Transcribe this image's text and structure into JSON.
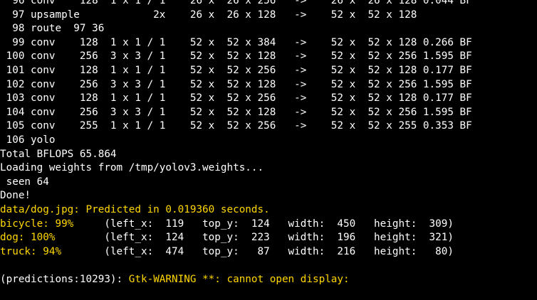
{
  "terminal": {
    "background": "#000000",
    "text_color": "#ffffff",
    "highlight_color": "#ffd700",
    "lines": [
      "  96 conv    128  1 x 1 / 1    26 x  26 x 256   ->    26 x  26 x 128 0.044 BF",
      "  97 upsample            2x    26 x  26 x 128   ->    52 x  52 x 128",
      "  98 route  97 36",
      "  99 conv    128  1 x 1 / 1    52 x  52 x 384   ->    52 x  52 x 128 0.266 BF",
      " 100 conv    256  3 x 3 / 1    52 x  52 x 128   ->    52 x  52 x 256 1.595 BF",
      " 101 conv    128  1 x 1 / 1    52 x  52 x 256   ->    52 x  52 x 128 0.177 BF",
      " 102 conv    256  3 x 3 / 1    52 x  52 x 128   ->    52 x  52 x 256 1.595 BF",
      " 103 conv    128  1 x 1 / 1    52 x  52 x 256   ->    52 x  52 x 128 0.177 BF",
      " 104 conv    256  3 x 3 / 1    52 x  52 x 128   ->    52 x  52 x 256 1.595 BF",
      " 105 conv    255  1 x 1 / 1    52 x  52 x 256   ->    52 x  52 x 255 0.353 BF",
      " 106 yolo",
      "Total BFLOPS 65.864",
      "Loading weights from /tmp/yolov3.weights...",
      " seen 64",
      "Done!"
    ],
    "predicted_line": "data/dog.jpg: Predicted in 0.019360 seconds.",
    "detections": [
      {
        "label": "bicycle: 99%",
        "rest": "     (left_x:  119   top_y:  124   width:  450   height:  309)"
      },
      {
        "label": "dog: 100%",
        "rest": "        (left_x:  124   top_y:  223   width:  196   height:  321)"
      },
      {
        "label": "truck: 94%",
        "rest": "       (left_x:  474   top_y:   87   width:  216   height:   80)"
      }
    ],
    "blank_line": " ",
    "warning": {
      "prefix": "(predictions:10293): ",
      "message": "Gtk-WARNING **: cannot open display:"
    }
  }
}
